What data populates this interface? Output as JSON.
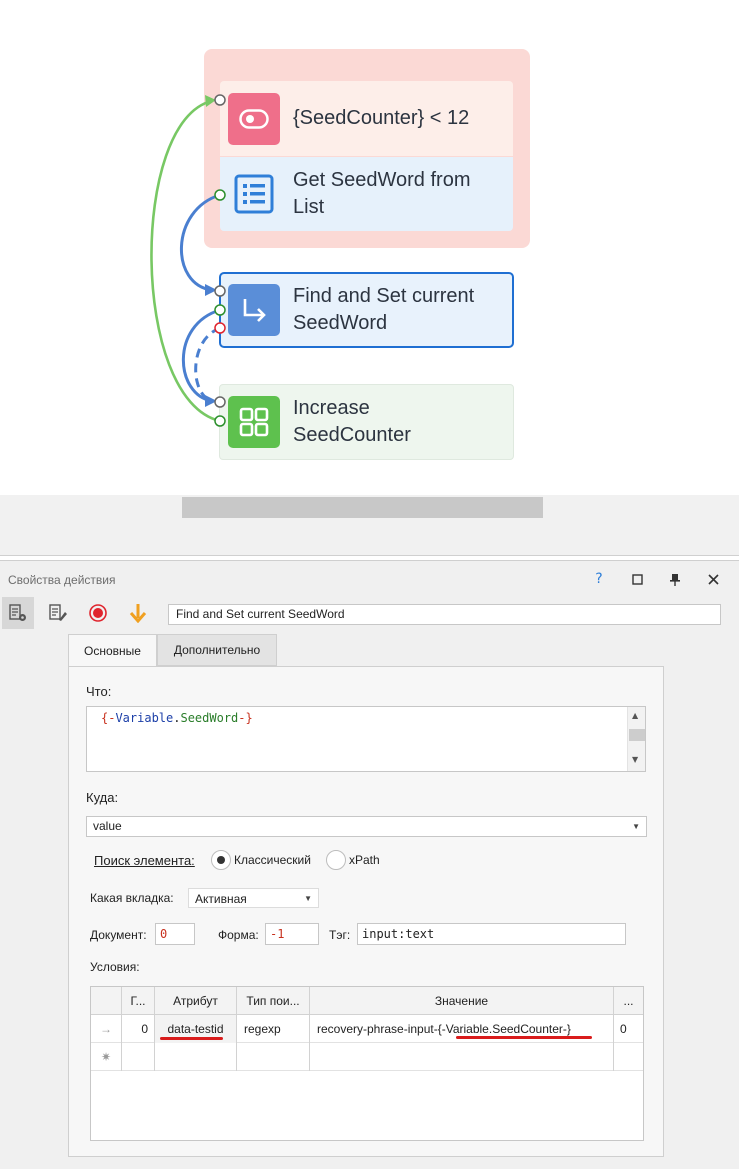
{
  "canvas": {
    "nodes": [
      {
        "id": "loop",
        "label_lines": [
          "{SeedCounter} < 12"
        ],
        "icon": "toggle-icon",
        "color": "#ef6f8a"
      },
      {
        "id": "get",
        "label_lines": [
          "Get SeedWord from",
          "List"
        ],
        "icon": "list-icon",
        "color": "#2f7fd8"
      },
      {
        "id": "find",
        "label_lines": [
          "Find and Set current",
          "SeedWord"
        ],
        "icon": "redirect-arrow-icon",
        "color": "#5a8ed8"
      },
      {
        "id": "inc",
        "label_lines": [
          "Increase",
          "SeedCounter"
        ],
        "icon": "grid-squares-icon",
        "color": "#5ec14e"
      }
    ],
    "colors": {
      "loop_bg": "#fbd9d5",
      "success_link": "#78c864",
      "normal_link": "#4a7fd0",
      "selected_border": "#1f6fd2",
      "error_port": "#e0242d"
    }
  },
  "panel": {
    "title": "Свойства действия",
    "help": "?",
    "maximize": "☐",
    "pin": "🖈",
    "close": "✕",
    "action_name": "Find and Set current SeedWord",
    "toolbar_icons": [
      "properties-icon",
      "edit-icon",
      "record-icon",
      "step-down-icon"
    ]
  },
  "tabs": [
    {
      "label": "Основные",
      "active": true
    },
    {
      "label": "Дополнительно",
      "active": false
    }
  ],
  "form": {
    "what_label": "Что:",
    "what_value_parts": [
      "{-",
      "Variable",
      ".",
      "SeedWord",
      "-}"
    ],
    "where_label": "Куда:",
    "where_value": "value",
    "search_label": "Поиск элемента:",
    "search_options": [
      {
        "label": "Классический",
        "selected": true
      },
      {
        "label": "xPath",
        "selected": false
      }
    ],
    "which_tab_label": "Какая вкладка:",
    "which_tab_value": "Активная",
    "document_label": "Документ:",
    "document_value": "0",
    "form_label": "Форма:",
    "form_value": "-1",
    "tag_label": "Тэг:",
    "tag_value": "input:text",
    "conditions_label": "Условия:"
  },
  "conditions": {
    "columns": [
      "",
      "Г...",
      "Атрибут",
      "Тип пои...",
      "Значение",
      "..."
    ],
    "rows": [
      {
        "marker": "→",
        "g": "0",
        "attribute": "data-testid",
        "type": "regexp",
        "value": "recovery-phrase-input-{-Variable.SeedCounter-}",
        "extra": "0"
      }
    ],
    "new_row_marker": "✷"
  }
}
